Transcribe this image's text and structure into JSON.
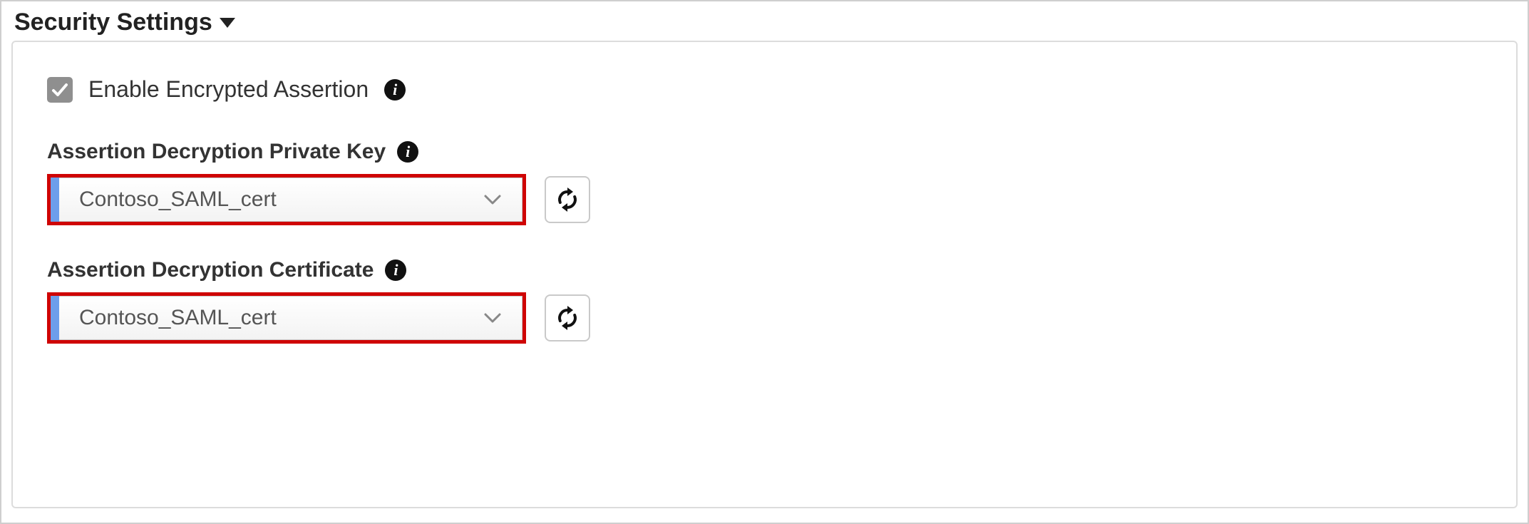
{
  "section": {
    "title": "Security Settings"
  },
  "checkbox": {
    "label": "Enable Encrypted Assertion",
    "checked": true
  },
  "fields": {
    "private_key": {
      "label": "Assertion Decryption Private Key",
      "value": "Contoso_SAML_cert"
    },
    "certificate": {
      "label": "Assertion Decryption Certificate",
      "value": "Contoso_SAML_cert"
    }
  },
  "icons": {
    "info_glyph": "i"
  }
}
